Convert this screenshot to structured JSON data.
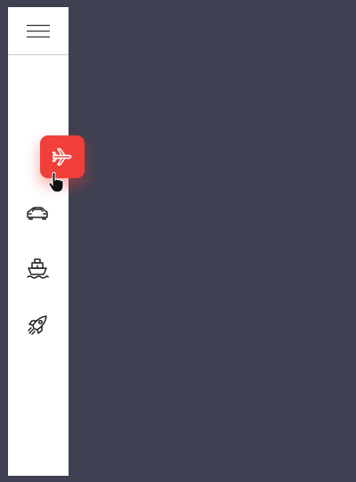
{
  "colors": {
    "background": "#3f4152",
    "sidebar": "#ffffff",
    "accent": "#f1403a",
    "icon": "#222222"
  },
  "sidebar": {
    "menu_icon": "hamburger-menu-icon",
    "items": [
      {
        "id": "plane",
        "icon": "airplane-icon",
        "active": true
      },
      {
        "id": "car",
        "icon": "car-icon",
        "active": false
      },
      {
        "id": "ship",
        "icon": "ship-icon",
        "active": false
      },
      {
        "id": "rocket",
        "icon": "rocket-icon",
        "active": false
      }
    ]
  }
}
